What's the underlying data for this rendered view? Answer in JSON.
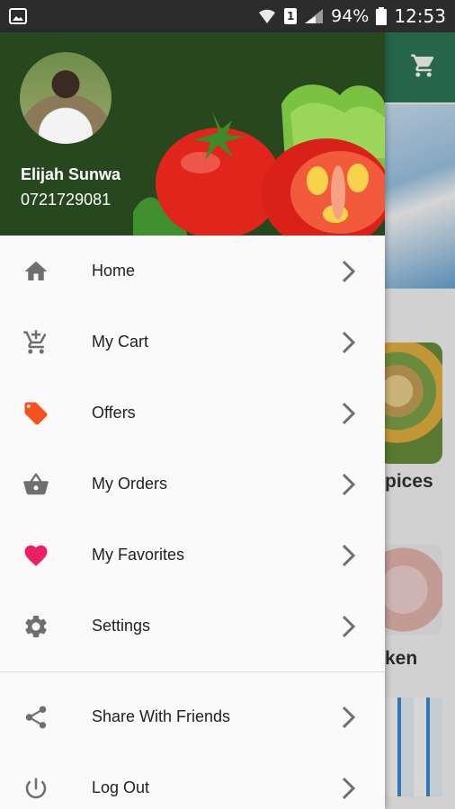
{
  "status_bar": {
    "battery_percent": "94%",
    "time": "12:53",
    "sim_badge": "1",
    "icons": [
      "gallery-notification-icon",
      "wifi-icon",
      "sim-icon",
      "signal-icon",
      "battery-icon"
    ]
  },
  "drawer": {
    "user": {
      "name": "Elijah Sunwa",
      "phone": "0721729081"
    },
    "menu_items": [
      {
        "label": "Home",
        "icon": "home-icon",
        "icon_color": "#6f6f6f"
      },
      {
        "label": "My Cart",
        "icon": "add-to-cart-icon",
        "icon_color": "#6f6f6f"
      },
      {
        "label": "Offers",
        "icon": "tag-icon",
        "icon_color": "#f4511e"
      },
      {
        "label": "My Orders",
        "icon": "basket-icon",
        "icon_color": "#6f6f6f"
      },
      {
        "label": "My Favorites",
        "icon": "heart-icon",
        "icon_color": "#e91e63"
      },
      {
        "label": "Settings",
        "icon": "gear-icon",
        "icon_color": "#6f6f6f"
      }
    ],
    "secondary_items": [
      {
        "label": "Share With Friends",
        "icon": "share-icon",
        "icon_color": "#6f6f6f"
      },
      {
        "label": "Log Out",
        "icon": "power-icon",
        "icon_color": "#6f6f6f"
      }
    ],
    "header_color": "#27471f"
  },
  "background": {
    "appbar_color": "#2f7a56",
    "category_labels": [
      "pices",
      "ken"
    ]
  }
}
